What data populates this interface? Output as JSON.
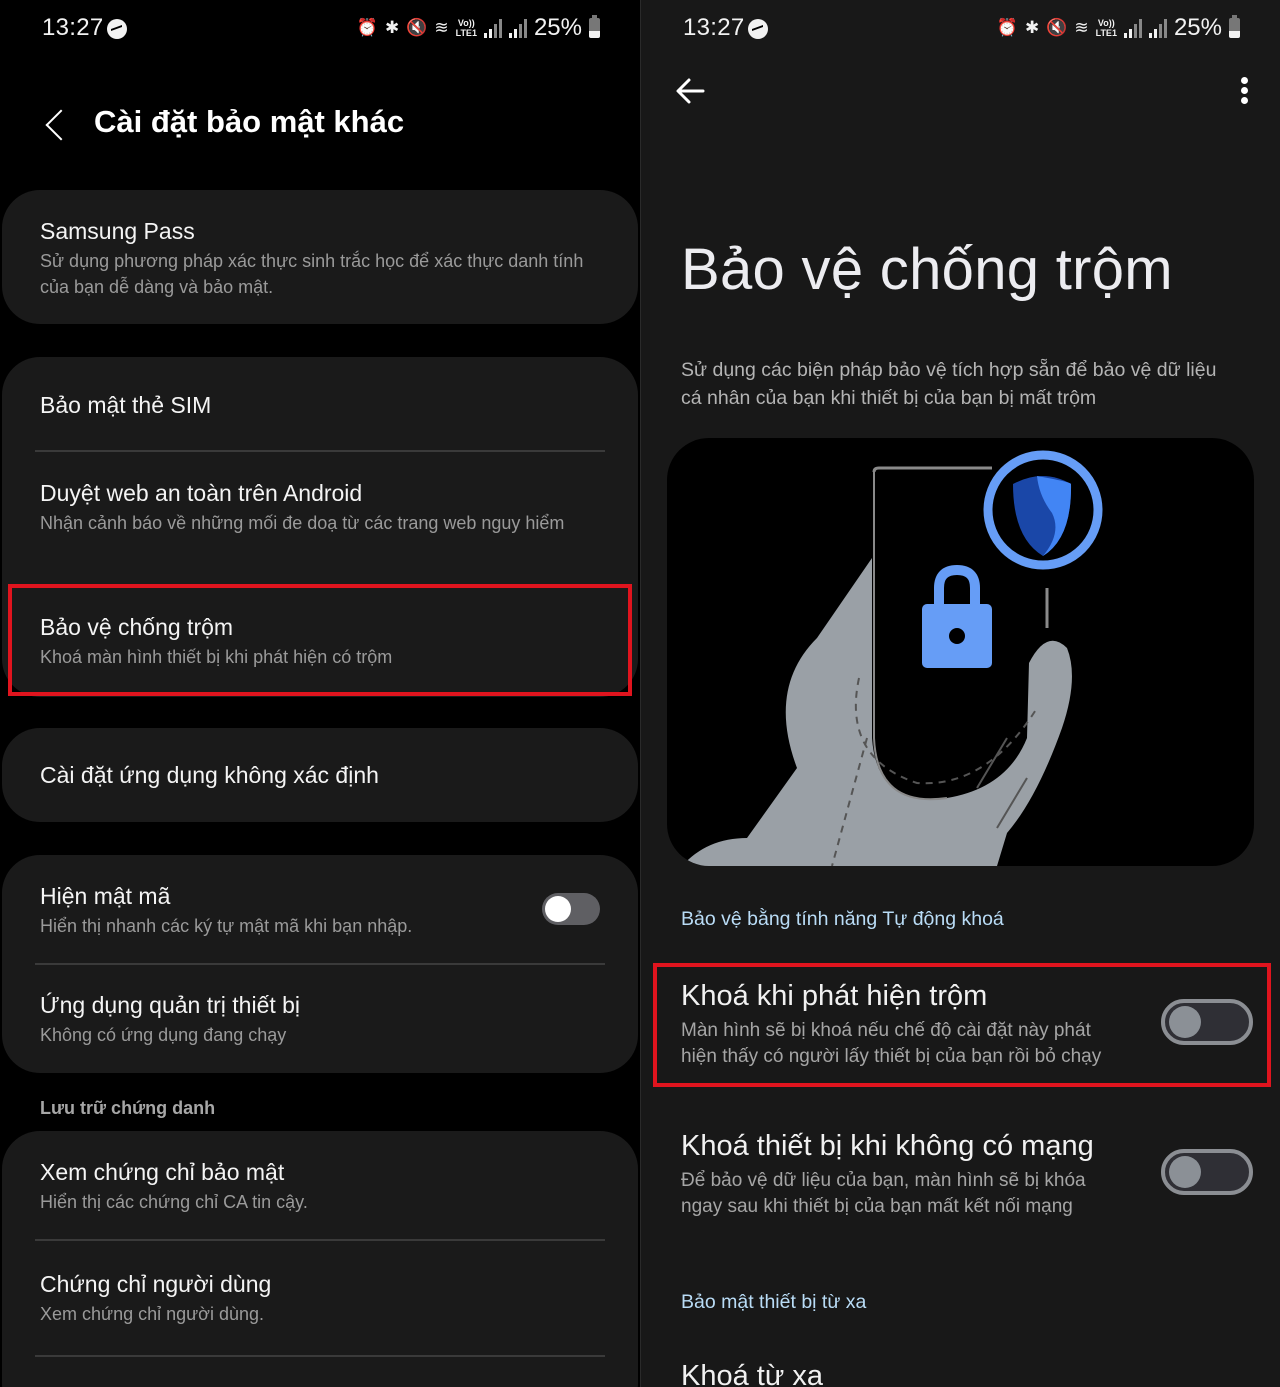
{
  "status_bar": {
    "time": "13:27",
    "lte_label_top": "Vo))",
    "lte_label_bottom": "LTE1",
    "battery": "25%",
    "icons": [
      "messenger-icon",
      "alarm-icon",
      "bluetooth-icon",
      "vibrate-icon",
      "wifi-icon",
      "lte-icon",
      "signal-icon",
      "signal-icon",
      "battery-icon"
    ]
  },
  "left_screen": {
    "title": "Cài đặt bảo mật khác",
    "samsung_pass": {
      "title": "Samsung Pass",
      "subtitle": "Sử dụng phương pháp xác thực sinh trắc học để xác thực danh tính của bạn dễ dàng và bảo mật."
    },
    "sim_security": {
      "title": "Bảo mật thẻ SIM"
    },
    "safe_browsing": {
      "title": "Duyệt web an toàn trên Android",
      "subtitle": "Nhận cảnh báo về những mối đe doạ từ các trang web nguy hiểm"
    },
    "theft_protection": {
      "title": "Bảo vệ chống trộm",
      "subtitle": "Khoá màn hình thiết bị khi phát hiện có trộm"
    },
    "unknown_apps": {
      "title": "Cài đặt ứng dụng không xác định"
    },
    "show_passwords": {
      "title": "Hiện mật mã",
      "subtitle": "Hiển thị nhanh các ký tự mật mã khi bạn nhập.",
      "enabled": false
    },
    "device_admin": {
      "title": "Ứng dụng quản trị thiết bị",
      "subtitle": "Không có ứng dụng đang chạy"
    },
    "credential_storage_label": "Lưu trữ chứng danh",
    "view_certs": {
      "title": "Xem chứng chỉ bảo mật",
      "subtitle": "Hiển thị các chứng chỉ CA tin cậy."
    },
    "user_certs": {
      "title": "Chứng chỉ người dùng",
      "subtitle": "Xem chứng chỉ người dùng."
    }
  },
  "right_screen": {
    "title": "Bảo vệ chống trộm",
    "description": "Sử dụng các biện pháp bảo vệ tích hợp sẵn để bảo vệ dữ liệu cá nhân của bạn khi thiết bị của bạn bị mất trộm",
    "section_autolock": "Bảo vệ bằng tính năng Tự động khoá",
    "theft_detection_lock": {
      "title": "Khoá khi phát hiện trộm",
      "subtitle": "Màn hình sẽ bị khoá nếu chế độ cài đặt này phát hiện thấy có người lấy thiết bị của bạn rồi bỏ chạy",
      "enabled": false
    },
    "offline_device_lock": {
      "title": "Khoá thiết bị khi không có mạng",
      "subtitle": "Để bảo vệ dữ liệu của bạn, màn hình sẽ bị khóa ngay sau khi thiết bị của bạn mất kết nối mạng",
      "enabled": false
    },
    "section_remote": "Bảo mật thiết bị từ xa",
    "remote_lock": {
      "title": "Khoá từ xa"
    }
  },
  "colors": {
    "highlight": "#e0141e",
    "accent_blue": "#669df6",
    "shield_dark": "#1a47a8",
    "section_blue": "#b9dcf6",
    "hand_gray": "#9aa0a6"
  }
}
